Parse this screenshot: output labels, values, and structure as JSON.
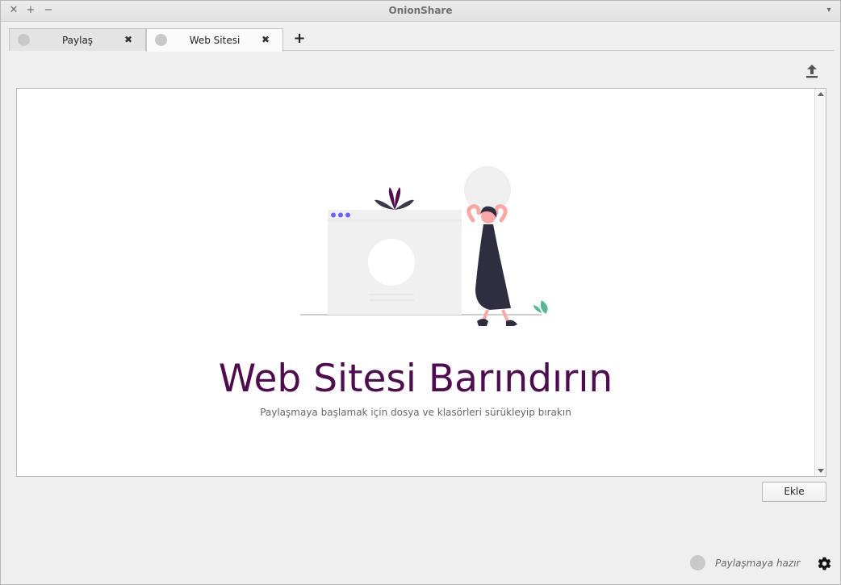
{
  "window": {
    "title": "OnionShare",
    "controls": {
      "close": "✕",
      "maximize": "+",
      "minimize": "−",
      "menu": "▾"
    }
  },
  "tabs": [
    {
      "label": "Paylaş",
      "close": "✖",
      "active": false
    },
    {
      "label": "Web Sitesi",
      "close": "✖",
      "active": true
    }
  ],
  "new_tab": {
    "label": "+"
  },
  "main": {
    "headline": "Web Sitesi Barındırın",
    "subline": "Paylaşmaya başlamak için dosya ve klasörleri sürükleyip bırakın",
    "add_button": "Ekle"
  },
  "status": {
    "text": "Paylaşmaya hazır",
    "indicator_color": "#c9c9c9"
  },
  "colors": {
    "accent": "#4e0d4e",
    "figure_dress": "#2f2e41",
    "skin": "#f9a8a8",
    "dots": "#6c63ff",
    "leaf": "#57b894"
  },
  "icons": [
    "upload-icon",
    "gear-icon",
    "close-icon",
    "plus-icon"
  ]
}
